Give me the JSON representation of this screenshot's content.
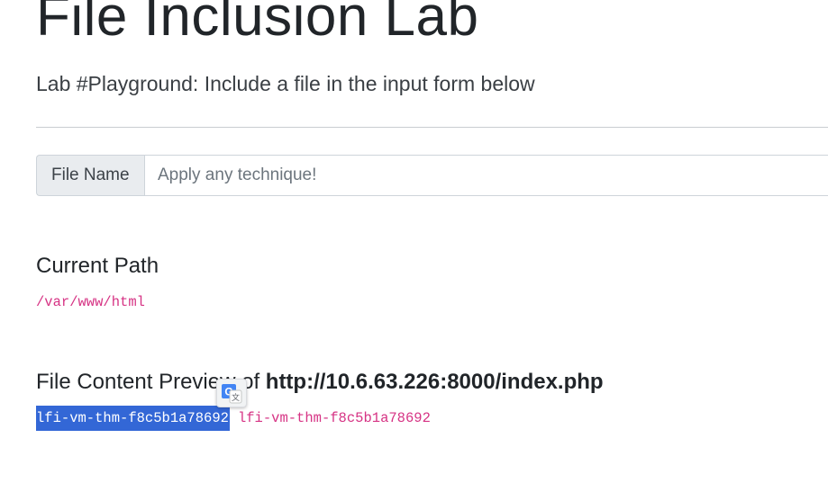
{
  "page": {
    "title": "File Inclusion Lab",
    "subtitle": "Lab #Playground: Include a file in the input form below"
  },
  "form": {
    "label": "File Name",
    "placeholder": "Apply any technique!",
    "value": ""
  },
  "current_path": {
    "heading": "Current Path",
    "value": "/var/www/html"
  },
  "preview": {
    "heading": "File Content Preview of",
    "url": "http://10.6.63.226:8000/index.php",
    "selected_text": "lfi-vm-thm-f8c5b1a78692",
    "content_text": "lfi-vm-thm-f8c5b1a78692"
  },
  "icons": {
    "translate_popup": "google-translate-icon"
  },
  "colors": {
    "code": "#d63384",
    "selection": "#3367d6",
    "input_addon_bg": "#e9ecef"
  }
}
